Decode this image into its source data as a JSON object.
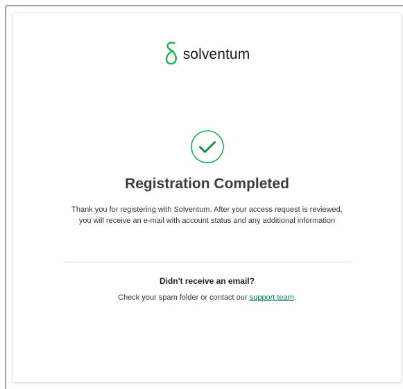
{
  "brand": {
    "name": "solventum",
    "accent_color": "#22b050"
  },
  "status_icon": "check-circle-icon",
  "heading": "Registration Completed",
  "message": {
    "line1": "Thank you for registering with Solventum. After your access request is reviewed,",
    "line2": "you will receive an e-mail with account status and any additional information"
  },
  "help": {
    "title": "Didn't receive an email?",
    "text_before": "Check your spam folder or contact our ",
    "link_label": "support team",
    "text_after": "."
  }
}
